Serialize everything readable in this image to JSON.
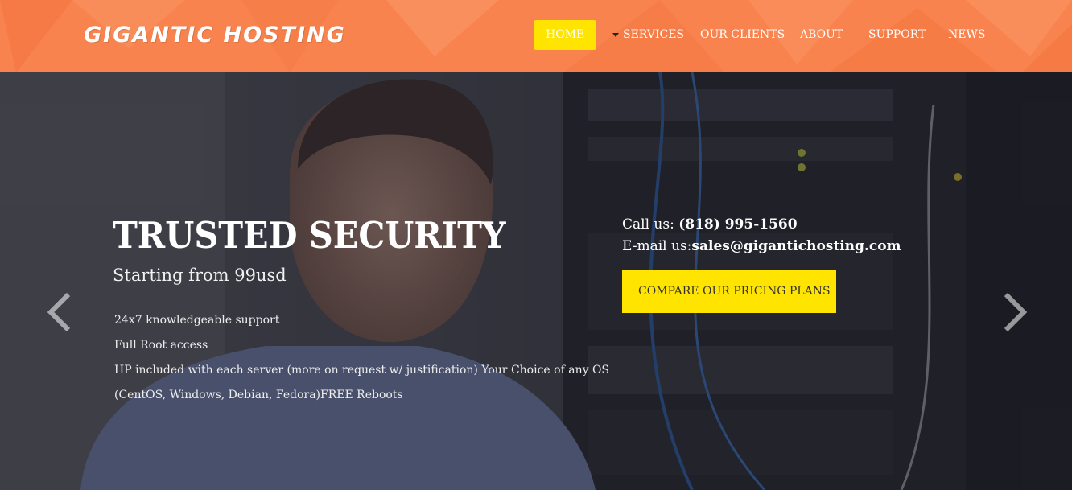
{
  "brand": {
    "logo_text": "GIGANTIC HOSTING"
  },
  "nav": {
    "items": [
      {
        "label": "HOME",
        "active": true
      },
      {
        "label": "SERVICES",
        "has_dropdown": true
      },
      {
        "label": "OUR CLIENTS"
      },
      {
        "label": "ABOUT"
      },
      {
        "label": "SUPPORT"
      },
      {
        "label": "NEWS"
      }
    ]
  },
  "hero": {
    "title": "TRUSTED SECURITY",
    "subtitle": "Starting from 99usd",
    "features": [
      "24x7 knowledgeable support",
      "Full Root access",
      "HP included with each server (more on request w/ justification) Your Choice of any OS (CentOS, Windows, Debian, Fedora)FREE Reboots"
    ],
    "contact": {
      "call_label": "Call us: ",
      "phone": "(818) 995-1560",
      "email_label": "E-mail us:",
      "email": "sales@gigantichosting.com"
    },
    "cta_label": "COMPARE OUR PRICING PLANS",
    "prev_icon": "chevron-left-icon",
    "next_icon": "chevron-right-icon"
  },
  "colors": {
    "header_bg": "#f8834e",
    "accent_yellow": "#ffe400"
  }
}
